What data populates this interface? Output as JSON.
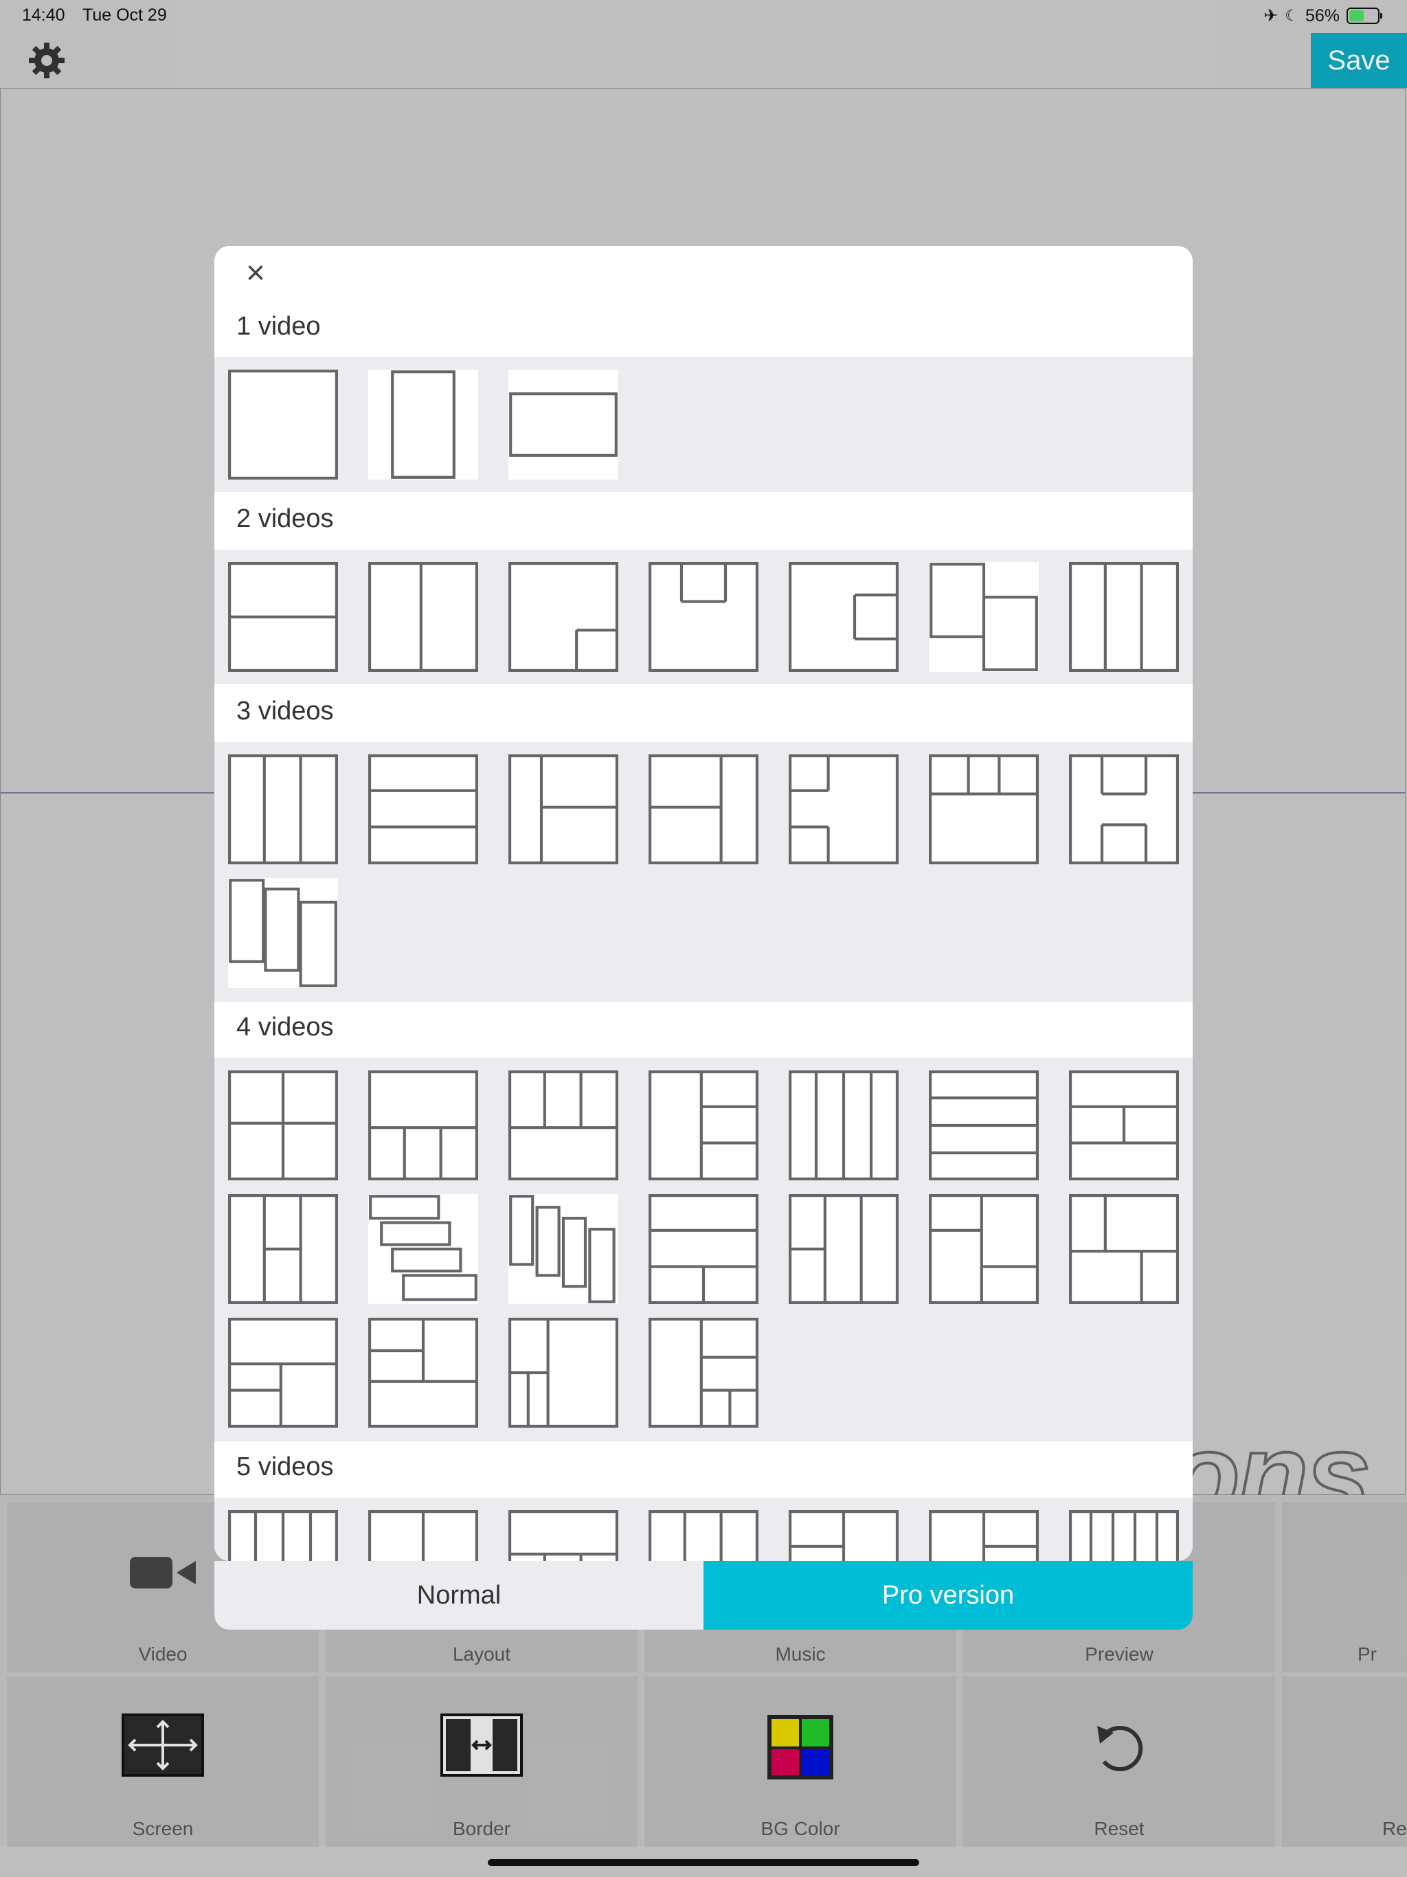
{
  "status": {
    "time": "14:40",
    "date": "Tue Oct 29",
    "battery": "56%",
    "battery_level": 0.56
  },
  "header": {
    "save_label": "Save"
  },
  "canvas": {
    "watermark_text": "ons"
  },
  "modal": {
    "sections": [
      {
        "title": "1 video",
        "count": 3
      },
      {
        "title": "2 videos",
        "count": 7
      },
      {
        "title": "3 videos",
        "count": 8
      },
      {
        "title": "4 videos",
        "count": 18
      },
      {
        "title": "5 videos",
        "count": 7
      }
    ],
    "footer": {
      "normal_label": "Normal",
      "pro_label": "Pro version"
    }
  },
  "toolbar": {
    "items": [
      {
        "label": "Video",
        "icon": "video-camera-icon"
      },
      {
        "label": "Layout",
        "icon": "layout-icon"
      },
      {
        "label": "Music",
        "icon": "music-icon"
      },
      {
        "label": "Preview",
        "icon": "preview-icon"
      },
      {
        "label": "Pr",
        "icon": "pro-icon"
      },
      {
        "label": "Screen",
        "icon": "screen-resize-icon"
      },
      {
        "label": "Border",
        "icon": "border-width-icon"
      },
      {
        "label": "BG Color",
        "icon": "color-palette-icon"
      },
      {
        "label": "Reset",
        "icon": "reset-icon"
      },
      {
        "label": "Re",
        "icon": "redo-icon"
      }
    ]
  },
  "colors": {
    "accent": "#00bcd4",
    "save_bg": "#0ba6bd",
    "layout_stroke": "#666666",
    "palette": [
      "#e5d400",
      "#22c62b",
      "#d1004f",
      "#0011d9"
    ]
  }
}
